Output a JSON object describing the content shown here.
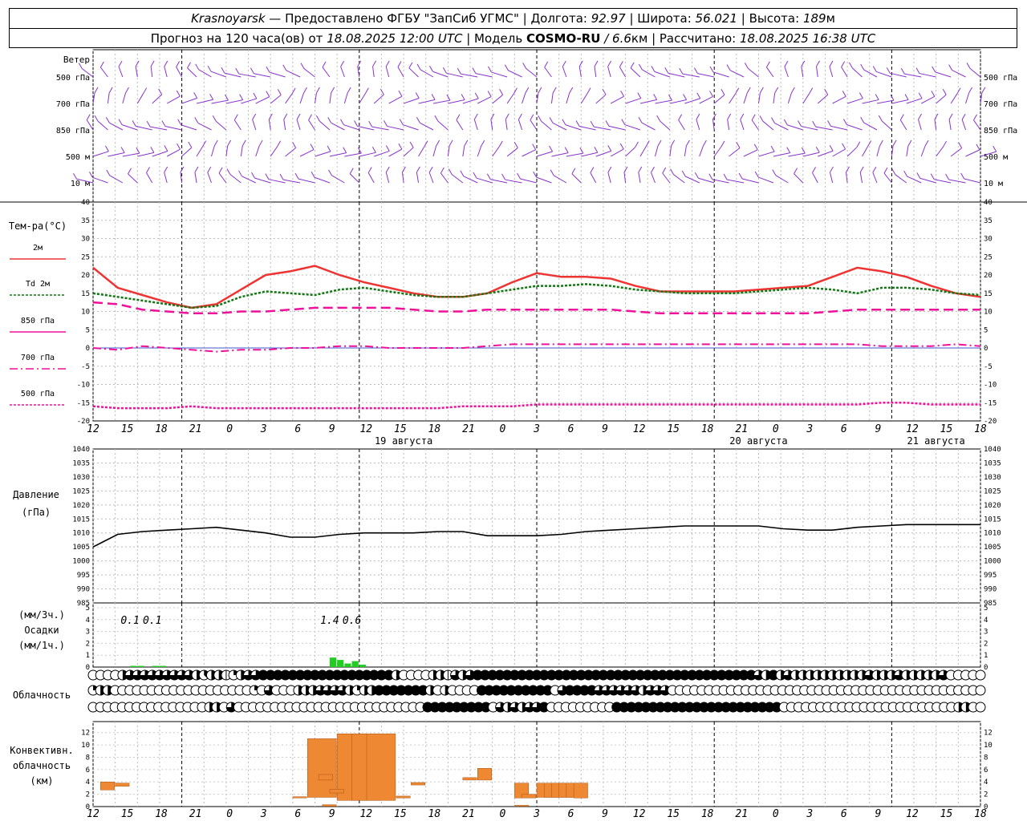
{
  "header": {
    "station": "Krasnoyarsk",
    "provider": " — Предоставлено ФГБУ \"ЗапСиб УГМС\" | Долгота: ",
    "lon": "92.97",
    "lat_label": " | Широта: ",
    "lat": "56.021",
    "alt_label": " | Высота: ",
    "alt": "189",
    "alt_unit": "м",
    "forecast_label": "Прогноз на 120 часа(ов) от ",
    "forecast_from": "18.08.2025 12:00 UTC",
    "model_label": " | Модель ",
    "model": "COSMO-RU",
    "model_res": " / 6.6",
    "model_res_unit": "км",
    "calc_label": " | Рассчитано: ",
    "calc_time": "18.08.2025 16:38 UTC"
  },
  "wind_panel": {
    "title": "Ветер",
    "levels": [
      "500 гПа",
      "700 гПа",
      "850 гПа",
      "500 м",
      "10 м"
    ]
  },
  "temp_panel": {
    "title": "Тем-ра(°C)",
    "legend": [
      "2м",
      "Td 2м",
      "850 гПа",
      "700 гПа",
      "500 гПа"
    ],
    "legend_td": "Td"
  },
  "pressure_panel": {
    "title_1": "Давление",
    "title_2": "(гПа)"
  },
  "precip_panel": {
    "title_1": "(мм/3ч.)",
    "title_2": "Осадки",
    "title_3": "(мм/1ч.)",
    "annotations": [
      {
        "x": 5,
        "label": "0.1"
      },
      {
        "x": 8,
        "label": "0.1"
      },
      {
        "x": 32,
        "label": "1.4"
      },
      {
        "x": 35,
        "label": "0.6"
      }
    ]
  },
  "cloud_panel": {
    "title": "Облачность"
  },
  "conv_panel": {
    "title_1": "Конвективн.",
    "title_2": "облачность",
    "title_3": "(км)"
  },
  "time_axis": {
    "tick_labels": [
      "12",
      "15",
      "18",
      "21",
      "0",
      "3",
      "6",
      "9",
      "12",
      "15",
      "18",
      "21",
      "0",
      "3",
      "6",
      "9",
      "12",
      "15",
      "18",
      "21",
      "0",
      "3",
      "6",
      "9",
      "12",
      "15",
      "18"
    ],
    "day_labels": [
      {
        "x": 42,
        "label": "19 августа"
      },
      {
        "x": 90,
        "label": "20 августа"
      },
      {
        "x": 114,
        "label": "21 августа"
      }
    ]
  },
  "colors": {
    "t2m": "#ee3333",
    "td2m": "#117711",
    "levels": "#ee1199",
    "wind": "#8833cc",
    "pressure": "#000000",
    "precip": "#22cc22",
    "conv": "#ee8833"
  },
  "chart_data": [
    {
      "type": "line",
      "name": "temperature",
      "ylim": [
        -20,
        40
      ],
      "x_hours": [
        0,
        3,
        6,
        9,
        12,
        15,
        18,
        21,
        24,
        27,
        30,
        33,
        36,
        39,
        42,
        45,
        48,
        51,
        54,
        57,
        60,
        63,
        66,
        69,
        72,
        75,
        78,
        81,
        84,
        87,
        90,
        93,
        96,
        99,
        102,
        105,
        108,
        111,
        114,
        117,
        120
      ],
      "series": [
        {
          "name": "2м",
          "values": [
            22,
            16.5,
            14.5,
            12.5,
            11,
            12,
            16,
            20,
            21,
            22.5,
            20,
            18,
            16.5,
            15,
            14,
            14,
            15,
            18,
            20.5,
            19.5,
            19.5,
            19,
            17,
            15.5,
            15.5,
            15.5,
            15.5,
            16,
            16.5,
            17,
            19.5,
            22,
            21,
            19.5,
            17,
            15,
            14
          ]
        },
        {
          "name": "Td 2м",
          "values": [
            15,
            14,
            13,
            12,
            11,
            11.5,
            14,
            15.5,
            15,
            14.5,
            16,
            16.5,
            15.5,
            14.5,
            14,
            14,
            15,
            16,
            17,
            17,
            17.5,
            17,
            16,
            15.5,
            15,
            15,
            15,
            15.5,
            16,
            16.5,
            16,
            15,
            16.5,
            16.5,
            16,
            15,
            14.5
          ]
        },
        {
          "name": "850 гПа",
          "values": [
            12.5,
            12,
            10.5,
            10,
            9.5,
            9.5,
            10,
            10,
            10.5,
            11,
            11,
            11,
            11,
            10.5,
            10,
            10,
            10.5,
            10.5,
            10.5,
            10.5,
            10.5,
            10.5,
            10,
            9.5,
            9.5,
            9.5,
            9.5,
            9.5,
            9.5,
            9.5,
            10,
            10.5,
            10.5,
            10.5,
            10.5,
            10.5,
            10.5
          ]
        },
        {
          "name": "700 гПа",
          "values": [
            0,
            -0.5,
            0.5,
            0,
            -0.5,
            -1,
            -0.5,
            -0.5,
            0,
            0,
            0.5,
            0.5,
            0,
            0,
            0,
            0,
            0.5,
            1,
            1,
            1,
            1,
            1,
            1,
            1,
            1,
            1,
            1,
            1,
            1,
            1,
            1,
            1,
            0.5,
            0.5,
            0.5,
            1,
            0.5
          ]
        },
        {
          "name": "500 гПа",
          "values": [
            -16,
            -16.5,
            -16.5,
            -16.5,
            -16,
            -16.5,
            -16.5,
            -16.5,
            -16.5,
            -16.5,
            -16.5,
            -16.5,
            -16.5,
            -16.5,
            -16.5,
            -16,
            -16,
            -16,
            -15.5,
            -15.5,
            -15.5,
            -15.5,
            -15.5,
            -15.5,
            -15.5,
            -15.5,
            -15.5,
            -15.5,
            -15.5,
            -15.5,
            -15.5,
            -15.5,
            -15,
            -15,
            -15.5,
            -15.5,
            -15.5
          ]
        }
      ]
    },
    {
      "type": "line",
      "name": "pressure",
      "ylim": [
        985,
        1040
      ],
      "series": [
        {
          "name": "Давление",
          "values": [
            1005,
            1009.5,
            1010.5,
            1011,
            1011.5,
            1012,
            1011,
            1010,
            1008.5,
            1008.5,
            1009.5,
            1010,
            1010,
            1010,
            1010.5,
            1010.5,
            1009,
            1009,
            1009,
            1009.5,
            1010.5,
            1011,
            1011.5,
            1012,
            1012.5,
            1012.5,
            1012.5,
            1012.5,
            1011.5,
            1011,
            1011,
            1012,
            1012.5,
            1013,
            1013,
            1013,
            1013
          ]
        }
      ]
    },
    {
      "type": "bar",
      "name": "precipitation",
      "ylim": [
        0,
        5
      ],
      "series": [
        {
          "name": "Осадки",
          "values": [
            [
              5,
              0.1
            ],
            [
              6,
              0.1
            ],
            [
              8,
              0.1
            ],
            [
              9,
              0.1
            ],
            [
              32,
              0.8
            ],
            [
              33,
              0.6
            ],
            [
              34,
              0.3
            ],
            [
              35,
              0.5
            ],
            [
              36,
              0.2
            ]
          ]
        }
      ]
    },
    {
      "type": "bar",
      "name": "convective_cloudiness",
      "ylim": [
        0,
        13
      ],
      "series": [
        {
          "name": "Конвективн. облачность",
          "values": [
            [
              0.5,
              2.7,
              4.0
            ],
            [
              1.5,
              3.3,
              3.8
            ],
            [
              13.5,
              1.4,
              1.6
            ],
            [
              14.5,
              1.5,
              11.0
            ],
            [
              16.5,
              1.5,
              10.0
            ],
            [
              17.5,
              1.6,
              3.8
            ],
            [
              18.5,
              1.9,
              4.2
            ],
            [
              19.5,
              2.0,
              4.2
            ],
            [
              20.5,
              1.4,
              1.7
            ],
            [
              21.5,
              3.5,
              3.9
            ],
            [
              33,
              1,
              11.8
            ],
            [
              35,
              1,
              11.8
            ],
            [
              37,
              1,
              11.8
            ],
            [
              25,
              4.3,
              4.7
            ],
            [
              26,
              4.3,
              6.2
            ],
            [
              28.5,
              0.05,
              0.2
            ],
            [
              30.5,
              4.3,
              5.2
            ],
            [
              31,
              0.05,
              0.3
            ],
            [
              32,
              2.2,
              2.8
            ],
            [
              30,
              0,
              0
            ],
            [
              57,
              1.4,
              3.8
            ],
            [
              58,
              1.4,
              2.0
            ],
            [
              60,
              1.5,
              3.8
            ],
            [
              61,
              1.5,
              3.8
            ],
            [
              62,
              1.5,
              3.8
            ],
            [
              63,
              1.5,
              3.8
            ],
            [
              64,
              1.5,
              3.8
            ],
            [
              65,
              1.4,
              3.8
            ]
          ]
        }
      ]
    },
    {
      "type": "heatmap",
      "name": "cloudiness",
      "rows": [
        [
          0,
          0,
          0,
          0,
          4,
          6,
          6,
          6,
          6,
          6,
          6,
          6,
          6,
          6,
          4,
          3,
          4,
          4,
          1,
          2,
          4,
          6,
          6,
          8,
          8,
          8,
          8,
          8,
          8,
          8,
          8,
          8,
          8,
          8,
          8,
          8,
          8,
          8,
          8,
          8,
          8,
          4,
          0,
          0,
          0,
          0,
          4,
          4,
          1,
          6,
          4,
          6,
          8,
          8,
          8,
          8,
          8,
          8,
          8,
          8,
          8,
          8,
          8,
          8,
          8,
          8,
          8,
          8,
          8,
          8,
          8,
          8,
          8,
          8,
          8,
          8,
          8,
          8,
          8,
          8,
          8,
          8,
          8,
          8,
          8,
          8,
          8,
          8,
          8,
          8,
          6,
          4,
          8,
          4,
          6,
          4,
          4,
          4,
          4,
          4,
          4,
          4,
          4,
          4,
          4,
          6,
          4,
          4,
          4,
          6,
          4,
          4,
          4,
          4,
          4,
          6,
          0,
          0,
          0,
          0,
          0
        ],
        [
          2,
          4,
          4,
          0,
          0,
          0,
          0,
          0,
          0,
          0,
          0,
          0,
          0,
          0,
          0,
          0,
          0,
          0,
          0,
          0,
          0,
          0,
          2,
          0,
          6,
          0,
          0,
          0,
          4,
          4,
          4,
          6,
          6,
          6,
          6,
          4,
          2,
          4,
          4,
          8,
          8,
          8,
          8,
          8,
          8,
          8,
          4,
          0,
          4,
          0,
          0,
          0,
          0,
          8,
          8,
          8,
          8,
          8,
          8,
          8,
          8,
          8,
          8,
          0,
          6,
          8,
          8,
          8,
          8,
          6,
          6,
          6,
          6,
          6,
          6,
          4,
          6,
          6,
          6,
          0,
          0,
          0,
          0,
          0,
          0,
          0,
          0,
          0,
          0,
          0,
          0,
          0,
          0,
          0,
          0,
          0,
          0,
          0,
          0,
          0,
          0,
          0,
          0,
          0,
          0,
          0,
          0,
          0,
          0,
          0,
          0,
          0,
          0,
          0,
          0,
          0,
          0,
          0,
          0,
          0,
          0,
          0
        ],
        [
          0,
          0,
          0,
          0,
          0,
          0,
          0,
          0,
          0,
          0,
          0,
          0,
          0,
          0,
          0,
          0,
          4,
          4,
          0,
          6,
          0,
          0,
          0,
          0,
          0,
          0,
          0,
          0,
          0,
          0,
          0,
          0,
          0,
          0,
          0,
          0,
          0,
          0,
          0,
          0,
          0,
          0,
          0,
          0,
          0,
          0,
          8,
          8,
          8,
          8,
          8,
          8,
          8,
          8,
          8,
          0,
          6,
          4,
          6,
          4,
          6,
          6,
          8,
          0,
          0,
          0,
          0,
          0,
          0,
          0,
          0,
          0,
          8,
          8,
          8,
          8,
          8,
          8,
          8,
          8,
          8,
          8,
          8,
          8,
          8,
          8,
          8,
          8,
          8,
          8,
          8,
          8,
          8,
          8,
          8,
          0,
          0,
          0,
          0,
          0,
          0,
          0,
          0,
          0,
          0,
          0,
          0,
          0,
          0,
          0,
          0,
          0,
          0,
          0,
          0,
          0,
          0,
          0,
          0,
          4,
          4,
          0,
          0
        ]
      ]
    }
  ]
}
